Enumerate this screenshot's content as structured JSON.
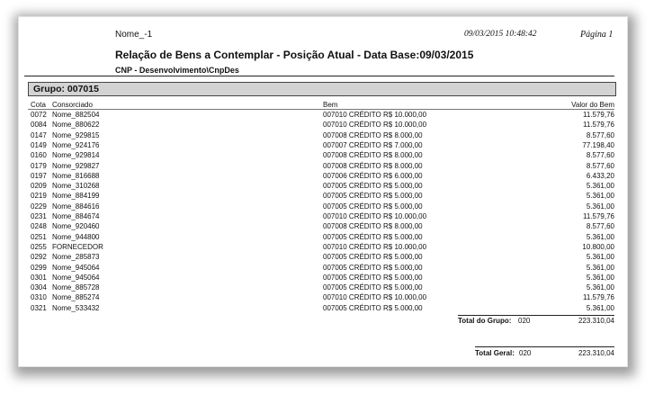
{
  "header": {
    "company": "Nome_-1",
    "datetime": "09/03/2015 10:48:42",
    "page": "Página 1",
    "title": "Relação de Bens a Contemplar - Posição Atual - Data Base:09/03/2015",
    "subtitle": "CNP - Desenvolvimento\\CnpDes"
  },
  "group": {
    "label": "Grupo: 007015"
  },
  "columns": {
    "cota": "Cota",
    "consorciado": "Consorciado",
    "bem": "Bem",
    "valor": "Valor do Bem"
  },
  "rows": [
    {
      "cota": "0072",
      "consorciado": "Nome_882504",
      "bem": "007010 CRÉDITO R$ 10.000,00",
      "valor": "11.579,76"
    },
    {
      "cota": "0084",
      "consorciado": "Nome_880622",
      "bem": "007010 CRÉDITO R$ 10.000,00",
      "valor": "11.579,76"
    },
    {
      "cota": "0147",
      "consorciado": "Nome_929815",
      "bem": "007008 CRÉDITO R$ 8.000,00",
      "valor": "8.577,60"
    },
    {
      "cota": "0149",
      "consorciado": "Nome_924176",
      "bem": "007007 CRÉDITO R$ 7.000,00",
      "valor": "77.198,40"
    },
    {
      "cota": "0160",
      "consorciado": "Nome_929814",
      "bem": "007008 CRÉDITO R$ 8.000,00",
      "valor": "8.577,60"
    },
    {
      "cota": "0179",
      "consorciado": "Nome_929827",
      "bem": "007008 CRÉDITO R$ 8.000,00",
      "valor": "8.577,60"
    },
    {
      "cota": "0197",
      "consorciado": "Nome_816688",
      "bem": "007006 CRÉDITO R$ 6.000,00",
      "valor": "6.433,20"
    },
    {
      "cota": "0209",
      "consorciado": "Nome_310268",
      "bem": "007005 CRÉDITO R$ 5.000,00",
      "valor": "5.361,00"
    },
    {
      "cota": "0219",
      "consorciado": "Nome_884199",
      "bem": "007005 CRÉDITO R$ 5.000,00",
      "valor": "5.361,00"
    },
    {
      "cota": "0229",
      "consorciado": "Nome_884616",
      "bem": "007005 CRÉDITO R$ 5.000,00",
      "valor": "5.361,00"
    },
    {
      "cota": "0231",
      "consorciado": "Nome_884674",
      "bem": "007010 CRÉDITO R$ 10.000,00",
      "valor": "11.579,76"
    },
    {
      "cota": "0248",
      "consorciado": "Nome_920460",
      "bem": "007008 CRÉDITO R$ 8.000,00",
      "valor": "8.577,60"
    },
    {
      "cota": "0251",
      "consorciado": "Nome_944800",
      "bem": "007005 CRÉDITO R$ 5.000,00",
      "valor": "5.361,00"
    },
    {
      "cota": "0255",
      "consorciado": "FORNECEDOR",
      "bem": "007010 CRÉDITO R$ 10.000,00",
      "valor": "10.800,00"
    },
    {
      "cota": "0292",
      "consorciado": "Nome_285873",
      "bem": "007005 CRÉDITO R$ 5.000,00",
      "valor": "5.361,00"
    },
    {
      "cota": "0299",
      "consorciado": "Nome_945064",
      "bem": "007005 CRÉDITO R$ 5.000,00",
      "valor": "5.361,00"
    },
    {
      "cota": "0301",
      "consorciado": "Nome_945064",
      "bem": "007005 CRÉDITO R$ 5.000,00",
      "valor": "5.361,00"
    },
    {
      "cota": "0304",
      "consorciado": "Nome_885728",
      "bem": "007005 CRÉDITO R$ 5.000,00",
      "valor": "5.361,00"
    },
    {
      "cota": "0310",
      "consorciado": "Nome_885274",
      "bem": "007010 CRÉDITO R$ 10.000,00",
      "valor": "11.579,76"
    },
    {
      "cota": "0321",
      "consorciado": "Nome_533432",
      "bem": "007005 CRÉDITO R$ 5.000,00",
      "valor": "5.361,00"
    }
  ],
  "totals": {
    "group_label": "Total do Grupo:",
    "group_count": "020",
    "group_value": "223.310,04",
    "general_label": "Total Geral:",
    "general_count": "020",
    "general_value": "223.310,04"
  }
}
